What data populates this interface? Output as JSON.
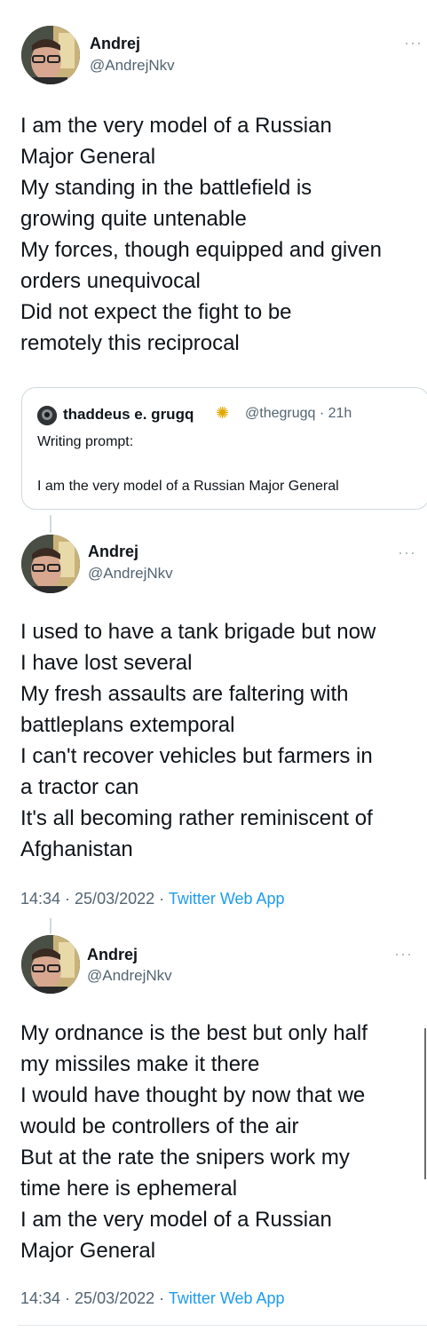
{
  "tweets": [
    {
      "author": {
        "name": "Andrej",
        "handle": "@AndrejNkv"
      },
      "more_icon": "more-icon",
      "lines": [
        "I am the very model of a Russian",
        "Major General",
        "My standing in the battlefield is",
        "growing quite untenable",
        "My forces, though equipped and given",
        "orders unequivocal",
        "Did not expect the fight to be",
        "remotely this reciprocal"
      ],
      "quote": {
        "name": "thaddeus e. grugq",
        "emoji_icon": "sunflower-icon",
        "handle_time": "@thegrugq · 21h",
        "label": "Writing prompt:",
        "text": "I am the very model of a Russian Major General"
      }
    },
    {
      "author": {
        "name": "Andrej",
        "handle": "@AndrejNkv"
      },
      "lines": [
        "I used to have a tank brigade but now",
        "I have lost several",
        "My fresh assaults are faltering with",
        "battleplans extemporal",
        "I can't recover vehicles but farmers in",
        "a tractor can",
        "It's all becoming rather reminiscent of",
        "Afghanistan"
      ],
      "meta": {
        "time_date": "14:34 · 25/03/2022 · ",
        "app": "Twitter Web App"
      }
    },
    {
      "author": {
        "name": "Andrej",
        "handle": "@AndrejNkv"
      },
      "lines": [
        "My ordnance is the best but only half",
        "my missiles make it there",
        "I would have thought by now that we",
        "would be controllers of the air",
        "But at the rate the snipers work my",
        "time here is ephemeral",
        "I am the very model of a Russian",
        "Major General"
      ],
      "meta": {
        "time_date": "14:34 · 25/03/2022 · ",
        "app": "Twitter Web App"
      }
    }
  ],
  "colors": {
    "link": "#1d9bf0",
    "secondary": "#536471",
    "border": "#cfd9de"
  }
}
